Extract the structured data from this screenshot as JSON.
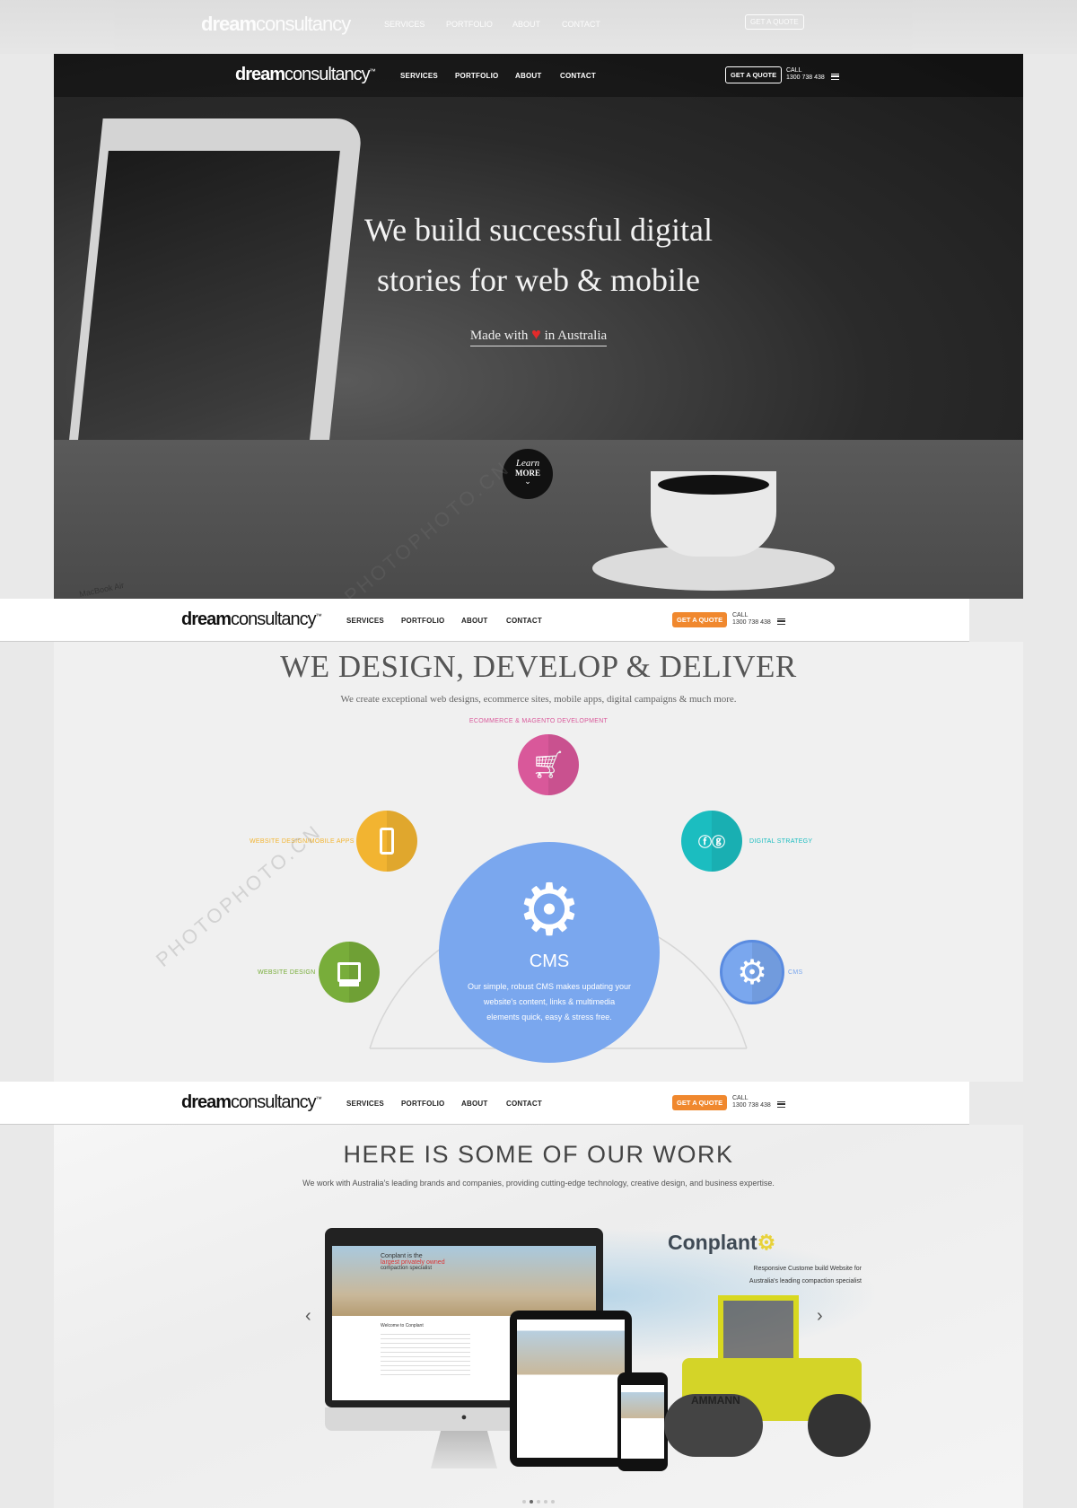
{
  "brand": {
    "logo_bold": "dream",
    "logo_light": "consultancy",
    "logo_mark": "™"
  },
  "nav": {
    "items": [
      "SERVICES",
      "PORTFOLIO",
      "ABOUT",
      "CONTACT"
    ],
    "quote_label": "GET A QUOTE",
    "call_label": "CALL",
    "phone": "1300 738 438"
  },
  "colors": {
    "accent": "#f0882e",
    "hero_bg": "#222222",
    "pink": "#d9589a",
    "yellow": "#f2b431",
    "teal": "#1bbdc0",
    "green": "#78ad3a",
    "blue": "#7aa7ee"
  },
  "hero": {
    "title_line1": "We build successful digital",
    "title_line2": "stories for web & mobile",
    "made_prefix": "Made with",
    "made_suffix": "in Australia",
    "learn_line1": "Learn",
    "learn_line2": "MORE",
    "laptop_brand": "MacBook Air"
  },
  "services": {
    "title": "WE DESIGN, DEVELOP & DELIVER",
    "subtitle": "We create exceptional web designs, ecommerce sites, mobile apps, digital campaigns & much more.",
    "items": [
      {
        "label": "ECOMMERCE & MAGENTO DEVELOPMENT",
        "icon": "cart-icon"
      },
      {
        "label": "WEBSITE DESIGN/MOBILE APPS",
        "icon": "mobile-icon"
      },
      {
        "label": "DIGITAL STRATEGY",
        "icon": "social-icon"
      },
      {
        "label": "WEBSITE DESIGN",
        "icon": "monitor-icon"
      },
      {
        "label": "CMS",
        "icon": "gear-icon"
      }
    ],
    "feature": {
      "title": "CMS",
      "line1": "Our simple, robust CMS makes updating your",
      "line2": "website's content, links & multimedia",
      "line3": "elements quick, easy & stress free."
    }
  },
  "work": {
    "title": "HERE IS SOME OF OUR WORK",
    "subtitle": "We work with Australia's leading brands and companies, providing cutting-edge technology, creative design, and business expertise.",
    "project": {
      "name": "Conplant",
      "desc1": "Responsive Custome build Website for",
      "desc2": "Australia's leading compaction specialist",
      "screen_headline": "Conplant is the",
      "screen_highlight": "largest privately owned",
      "screen_tail": "compaction specialist",
      "screen_welcome": "Welcome to Conplant",
      "roller_brand": "AMMANN"
    },
    "prev": "‹",
    "next": "›",
    "slides": 5,
    "active_slide": 2
  }
}
